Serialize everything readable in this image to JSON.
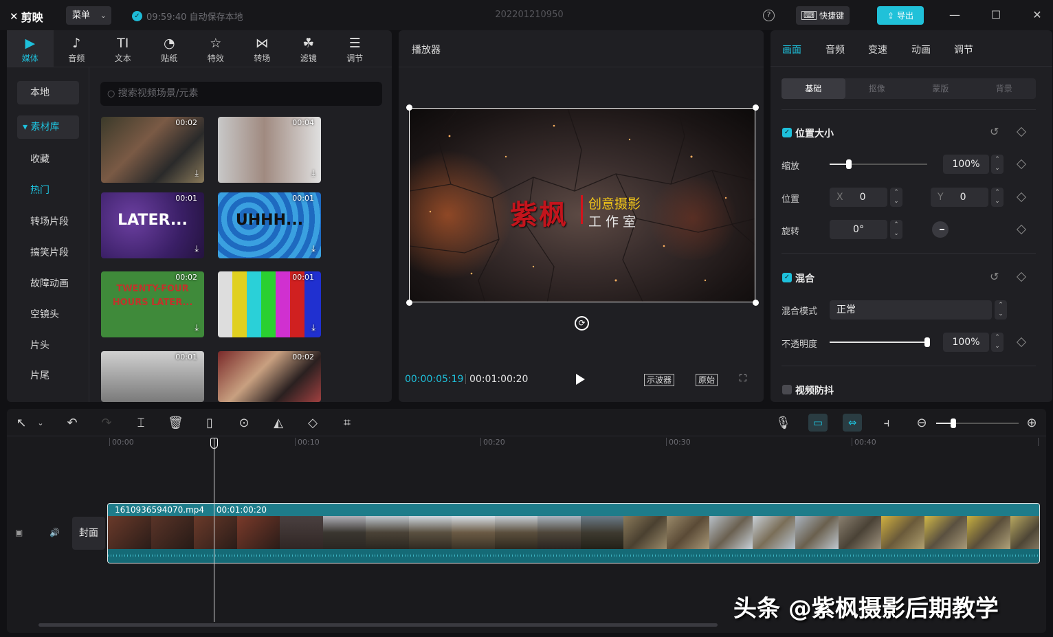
{
  "app": {
    "logo": "剪映",
    "menu_label": "菜单",
    "autosave_text": "09:59:40 自动保存本地",
    "project_title": "202201210950",
    "shortcut_label": "快捷键",
    "export_label": "导出"
  },
  "media": {
    "tabs": [
      {
        "label": "媒体",
        "icon": "media-icon"
      },
      {
        "label": "音频",
        "icon": "audio-icon"
      },
      {
        "label": "文本",
        "icon": "text-icon"
      },
      {
        "label": "贴纸",
        "icon": "sticker-icon"
      },
      {
        "label": "特效",
        "icon": "effects-icon"
      },
      {
        "label": "转场",
        "icon": "transition-icon"
      },
      {
        "label": "滤镜",
        "icon": "filter-icon"
      },
      {
        "label": "调节",
        "icon": "adjust-icon"
      }
    ],
    "sidebar": [
      "本地",
      "▾ 素材库",
      "收藏",
      "热门",
      "转场片段",
      "搞笑片段",
      "故障动画",
      "空镜头",
      "片头",
      "片尾"
    ],
    "search_placeholder": "搜索视频场景/元素",
    "thumbnails": [
      {
        "duration": "00:02",
        "text": ""
      },
      {
        "duration": "00:04",
        "text": ""
      },
      {
        "duration": "00:01",
        "text": "LATER..."
      },
      {
        "duration": "00:01",
        "text": "UHHH..."
      },
      {
        "duration": "00:02",
        "text": "TWENTY-FOUR HOURS LATER..."
      },
      {
        "duration": "00:01",
        "text": ""
      },
      {
        "duration": "00:01",
        "text": ""
      },
      {
        "duration": "00:02",
        "text": ""
      }
    ]
  },
  "player": {
    "title": "播放器",
    "overlay_main": "紫枫",
    "overlay_sub1": "创意摄影",
    "overlay_sub2": "工作室",
    "current_time": "00:00:05:19",
    "total_time": "00:01:00:20",
    "scope_label": "示波器",
    "ratio_label": "原始"
  },
  "props": {
    "tabs": [
      "画面",
      "音频",
      "变速",
      "动画",
      "调节"
    ],
    "subtabs": [
      "基础",
      "抠像",
      "蒙版",
      "背景"
    ],
    "position_size": "位置大小",
    "scale_label": "缩放",
    "scale_value": "100%",
    "scale_level": 0.2,
    "position_label": "位置",
    "x_label": "X",
    "x_value": "0",
    "y_label": "Y",
    "y_value": "0",
    "rotate_label": "旋转",
    "rotate_value": "0°",
    "blend_title": "混合",
    "blend_mode_label": "混合模式",
    "blend_mode_value": "正常",
    "opacity_label": "不透明度",
    "opacity_value": "100%",
    "opacity_level": 1.0,
    "stabilize_title": "视频防抖"
  },
  "timeline": {
    "ruler": [
      "00:00",
      "00:10",
      "00:20",
      "00:30",
      "00:40"
    ],
    "clip_name": "1610936594070.mp4",
    "clip_duration": "00:01:00:20",
    "cover_label": "封面"
  },
  "watermark": "头条 @紫枫摄影后期教学"
}
